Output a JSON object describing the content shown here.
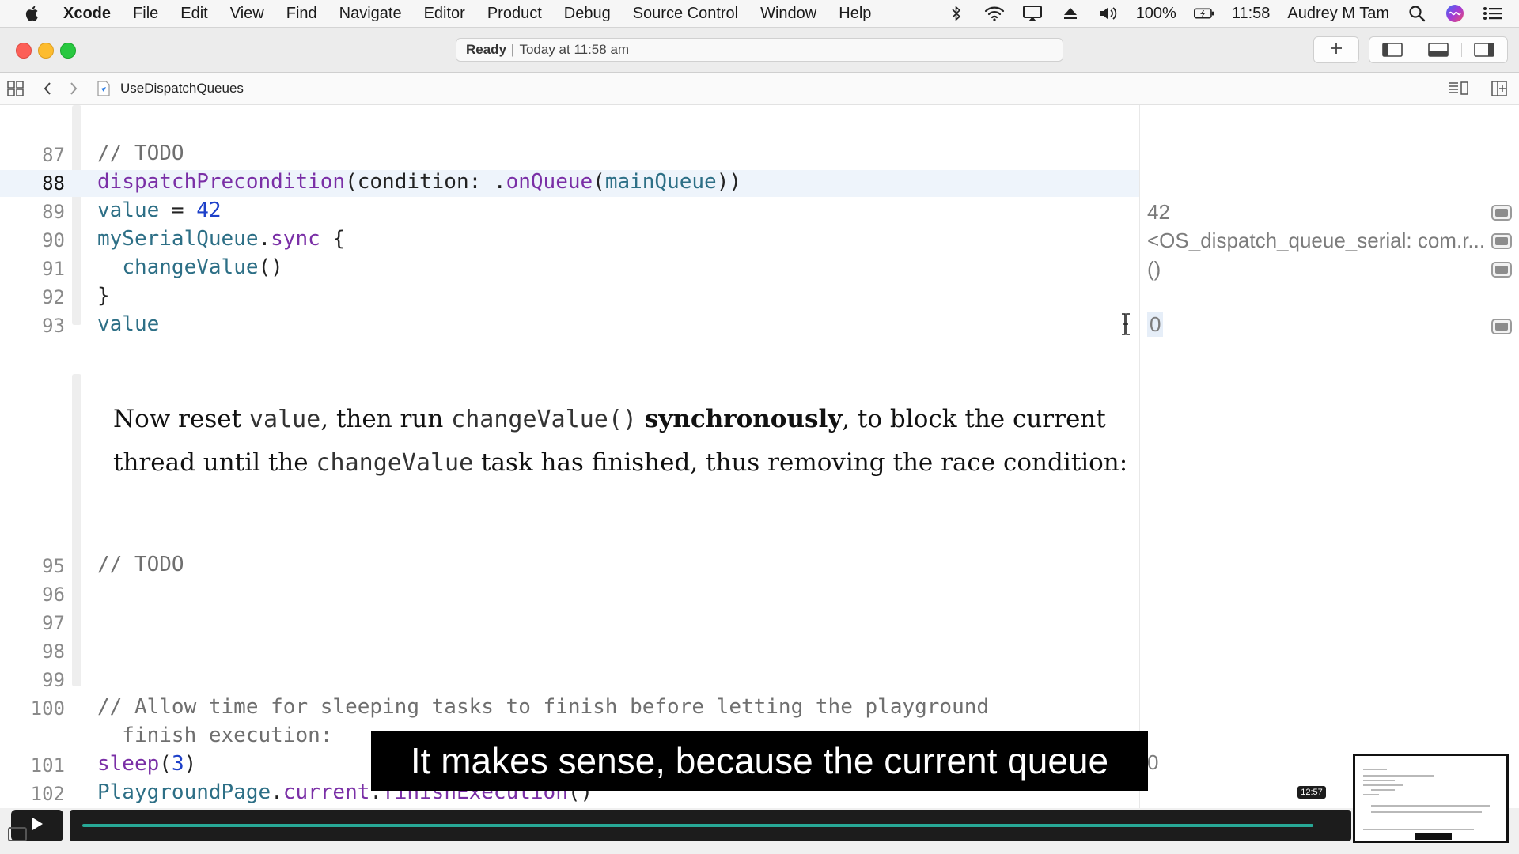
{
  "menubar": {
    "app": "Xcode",
    "menus": [
      "File",
      "Edit",
      "View",
      "Find",
      "Navigate",
      "Editor",
      "Product",
      "Debug",
      "Source Control",
      "Window",
      "Help"
    ],
    "battery": "100%",
    "time": "11:58",
    "user": "Audrey M Tam"
  },
  "toolbar": {
    "status_bold": "Ready",
    "status_separator": "|",
    "status_text": "Today at 11:58 am"
  },
  "jumpbar": {
    "filename": "UseDispatchQueues"
  },
  "editor": {
    "lines": [
      {
        "num": "87",
        "text": "// TODO"
      },
      {
        "num": "88",
        "text": "dispatchPrecondition(condition: .onQueue(mainQueue))"
      },
      {
        "num": "89",
        "text": "value = 42"
      },
      {
        "num": "90",
        "text": "mySerialQueue.sync {"
      },
      {
        "num": "91",
        "text": "  changeValue()"
      },
      {
        "num": "92",
        "text": "}"
      },
      {
        "num": "93",
        "text": "value"
      },
      {
        "num": "95",
        "text": "// TODO"
      },
      {
        "num": "96",
        "text": ""
      },
      {
        "num": "97",
        "text": ""
      },
      {
        "num": "98",
        "text": ""
      },
      {
        "num": "99",
        "text": ""
      },
      {
        "num": "100",
        "text": "// Allow time for sleeping tasks to finish before letting the playground"
      },
      {
        "num": "100b",
        "text": "  finish execution:"
      },
      {
        "num": "101",
        "text": "sleep(3)"
      },
      {
        "num": "102",
        "text": "PlaygroundPage.current.finishExecution()"
      }
    ],
    "current_line": "88",
    "prose": {
      "p1": "Now reset ",
      "c1": "value",
      "p2": ", then run ",
      "c2": "changeValue()",
      "bold": "synchronously",
      "p3": ", to block the current thread until the ",
      "c3": "changeValue",
      "p4": " task has finished, thus removing the race condition:"
    }
  },
  "results": {
    "r89": "42",
    "r90": "<OS_dispatch_queue_serial: com.r...",
    "r91": "()",
    "r93": "0",
    "r101": "0"
  },
  "caption": "It makes sense, because the current queue",
  "video": {
    "scrub_time": "12:57",
    "progress": 0.98
  },
  "colors": {
    "comment": "#6f6f6f",
    "function": "#7a2fa6",
    "variable": "#2d6f86",
    "number": "#1d40c9",
    "progress": "#27a896"
  }
}
